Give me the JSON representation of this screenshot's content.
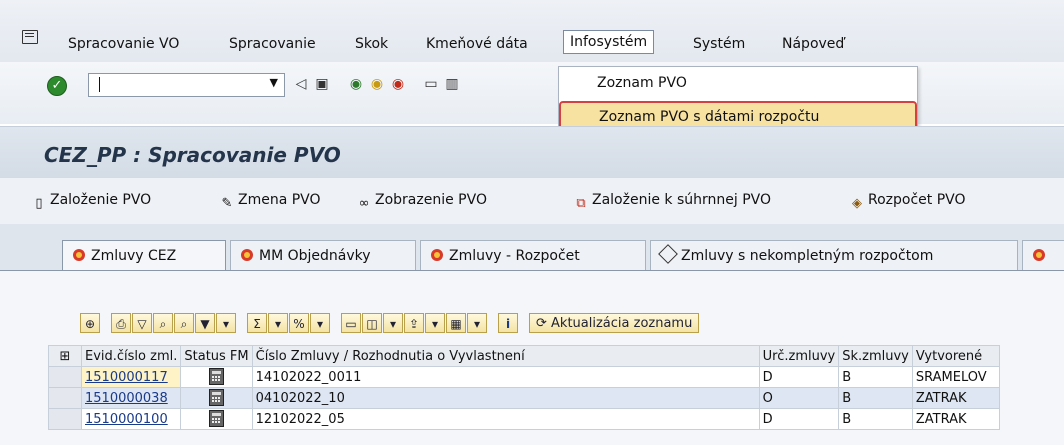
{
  "menubar": {
    "items": [
      "Spracovanie VO",
      "Spracovanie",
      "Skok",
      "Kmeňové dáta",
      "Infosystém",
      "Systém",
      "Nápoveď"
    ],
    "open_index": 4
  },
  "dropdown": {
    "items": [
      "Zoznam PVO",
      "Zoznam PVO s dátami rozpočtu"
    ],
    "highlighted_index": 1
  },
  "title": "CEZ_PP : Spracovanie PVO",
  "app_toolbar": {
    "buttons": [
      "Založenie PVO",
      "Zmena PVO",
      "Zobrazenie PVO",
      "Založenie k súhrnnej PVO",
      "Rozpočet PVO"
    ]
  },
  "tabs": [
    "Zmluvy CEZ",
    "MM Objednávky",
    "Zmluvy - Rozpočet",
    "Zmluvy s nekompletným rozpočtom"
  ],
  "active_tab_index": 0,
  "alv_toolbar": {
    "refresh_label": "Aktualizácia zoznamu"
  },
  "table": {
    "columns": [
      "Evid.číslo zml.",
      "Status FM",
      "Číslo Zmluvy / Rozhodnutia o Vyvlastnení",
      "Urč.zmluvy",
      "Sk.zmluvy",
      "Vytvorené"
    ],
    "rows": [
      {
        "evid": "1510000117",
        "zmluva": "14102022_0011",
        "urc": "D",
        "sk": "B",
        "vytvorene": "SRAMELOV"
      },
      {
        "evid": "1510000038",
        "zmluva": "04102022_10",
        "urc": "O",
        "sk": "B",
        "vytvorene": "ZATRAK"
      },
      {
        "evid": "1510000100",
        "zmluva": "12102022_05",
        "urc": "D",
        "sk": "B",
        "vytvorene": "ZATRAK"
      }
    ]
  }
}
